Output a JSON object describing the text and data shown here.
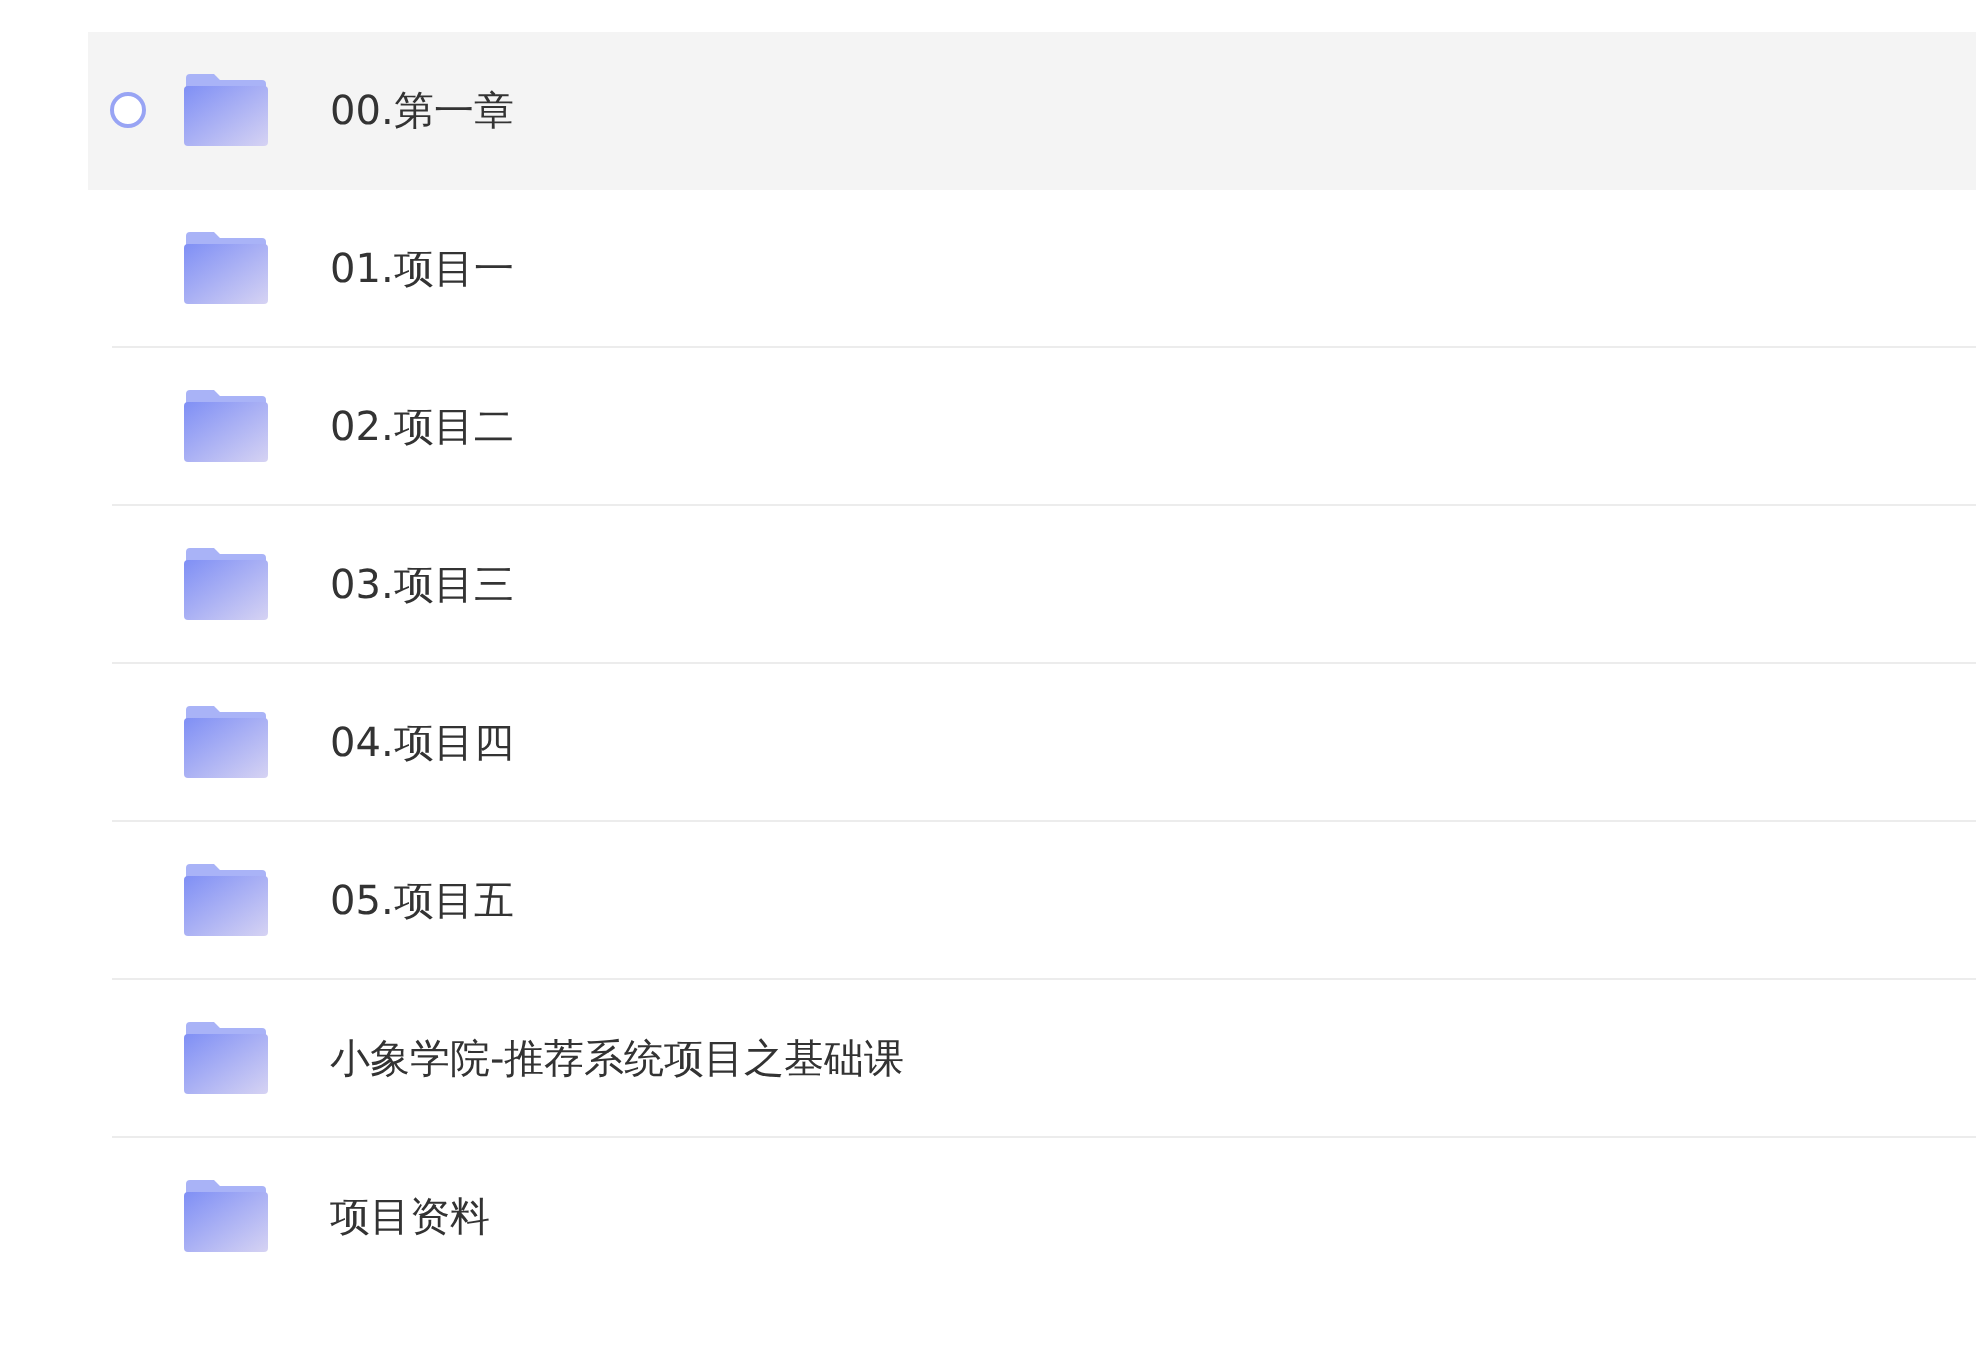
{
  "folders": [
    {
      "name": "00.第一章",
      "hovered": true
    },
    {
      "name": "01.项目一",
      "hovered": false
    },
    {
      "name": "02.项目二",
      "hovered": false
    },
    {
      "name": "03.项目三",
      "hovered": false
    },
    {
      "name": "04.项目四",
      "hovered": false
    },
    {
      "name": "05.项目五",
      "hovered": false
    },
    {
      "name": "小象学院-推荐系统项目之基础课",
      "hovered": false
    },
    {
      "name": "项目资料",
      "hovered": false
    }
  ]
}
